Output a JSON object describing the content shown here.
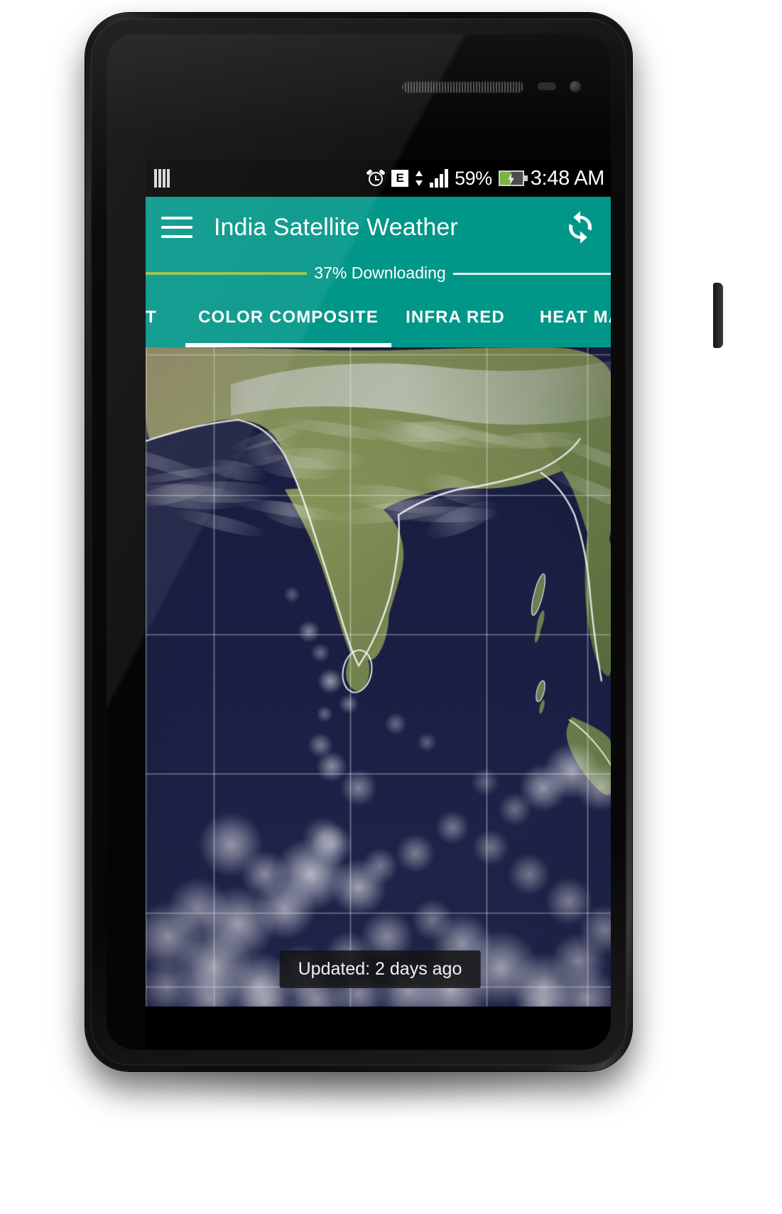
{
  "device": {
    "name": "android-phone-mockup"
  },
  "status_bar": {
    "sim_icon": "sim-bars-icon",
    "alarm_icon": "alarm-icon",
    "network_type": "E",
    "data_arrows_icon": "data-updown-icon",
    "signal_icon": "signal-bars-icon",
    "battery_percent": "59%",
    "battery_icon": "battery-charging-icon",
    "time": "3:48 AM"
  },
  "app_bar": {
    "menu_icon": "hamburger-menu-icon",
    "title": "India Satellite Weather",
    "refresh_icon": "refresh-icon"
  },
  "progress": {
    "label": "37% Downloading",
    "percent": 37,
    "track_color": "#8BC34A",
    "remaining_color": "#E8F3F1"
  },
  "tabs": {
    "items": [
      {
        "label": "T",
        "active": false,
        "partial": true
      },
      {
        "label": "COLOR COMPOSITE",
        "active": true,
        "partial": false
      },
      {
        "label": "INFRA RED",
        "active": false,
        "partial": false
      },
      {
        "label": "HEAT MAP",
        "active": false,
        "partial": false
      }
    ],
    "indicator_color": "#FFFFFF"
  },
  "map": {
    "name": "india-satellite-image",
    "alt": "Color composite satellite view of India and the Indian Ocean with grid overlay"
  },
  "toast": {
    "message": "Updated: 2 days ago"
  },
  "theme": {
    "primary": "#009688",
    "status_bar_bg": "#000000",
    "accent_progress": "#8BC34A"
  }
}
